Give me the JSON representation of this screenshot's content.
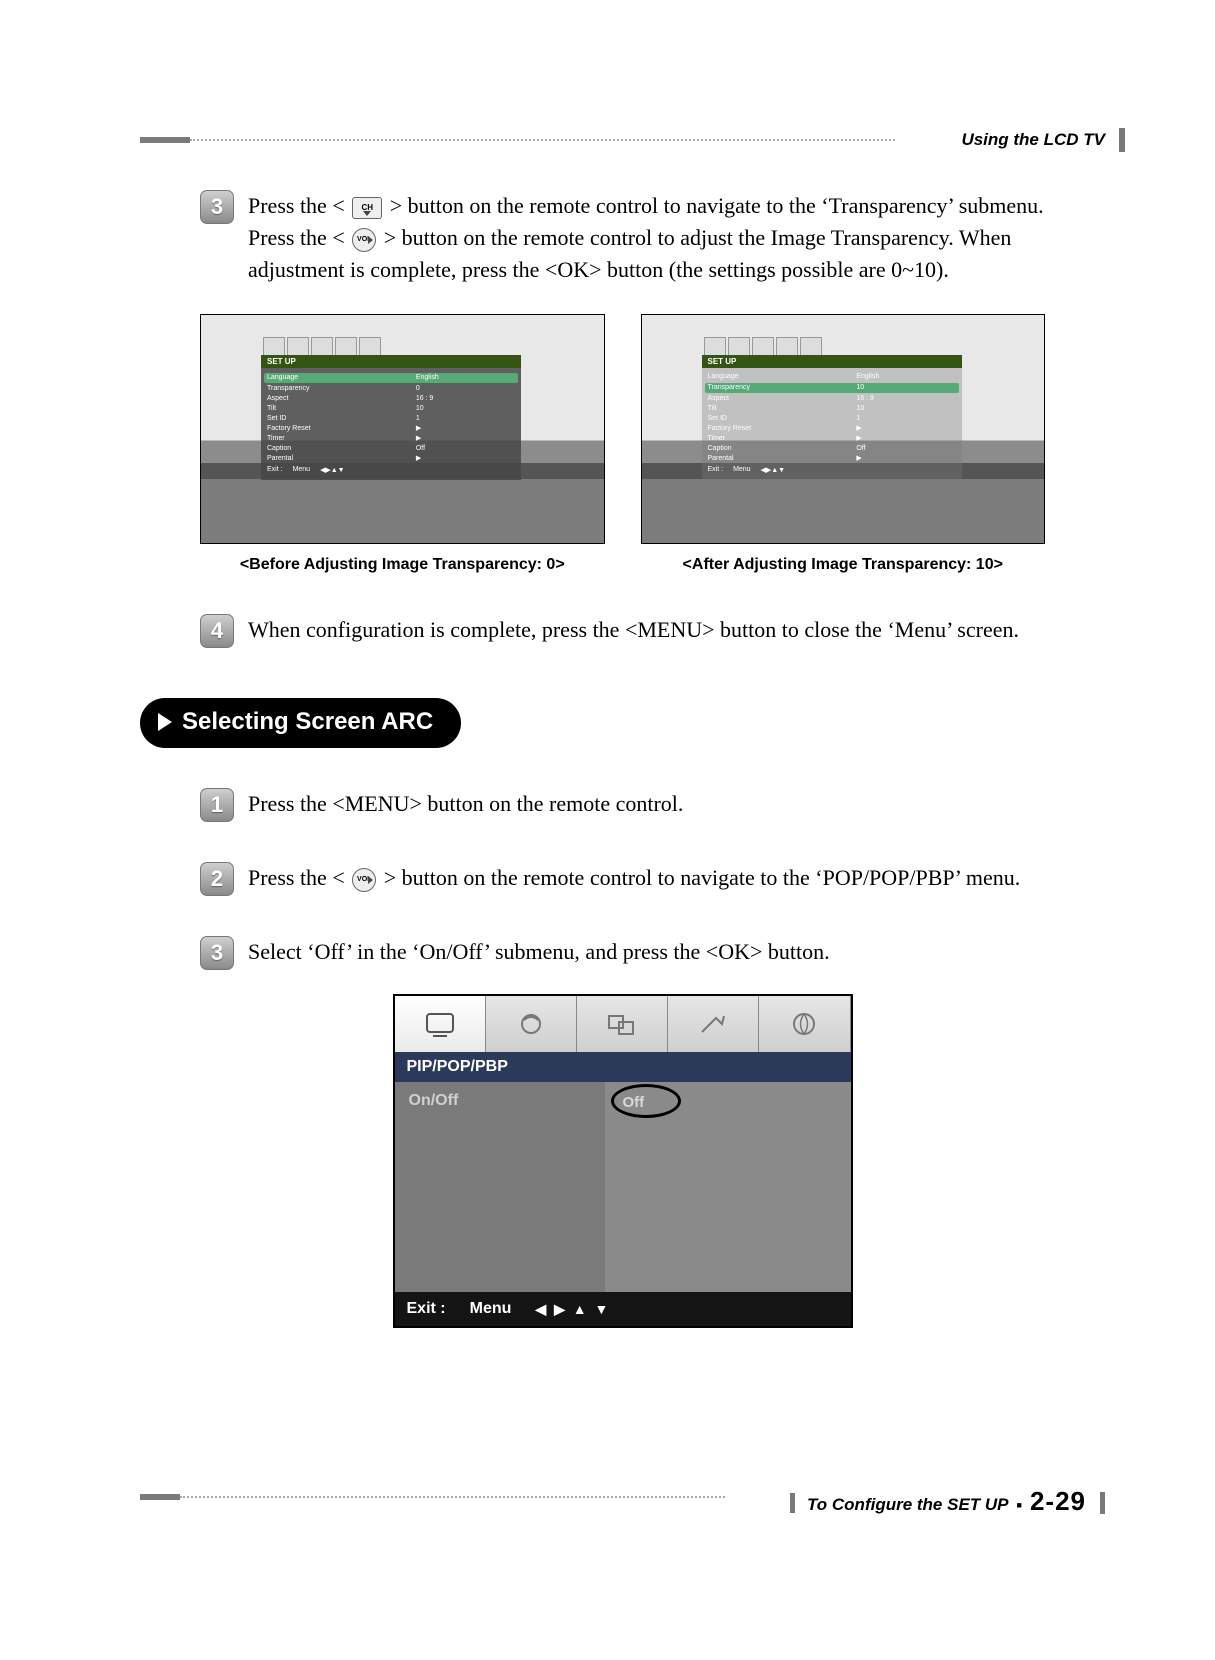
{
  "header": {
    "section": "Using the LCD TV"
  },
  "steps_top": {
    "s3": {
      "num": "3",
      "text_a": "Press the <",
      "text_b": "> button on the remote control to navigate to the ‘Transparency’ submenu. Press the <",
      "text_c": "> button on the remote control to adjust the Image Transparency. When adjustment is complete, press the <OK> button (the settings possible are 0~10)."
    },
    "s4": {
      "num": "4",
      "text": "When configuration is complete, press the <MENU> button to close the ‘Menu’ screen."
    }
  },
  "captions": {
    "before": "<Before Adjusting Image Transparency: 0>",
    "after": "<After Adjusting Image Transparency: 10>"
  },
  "osd_small": {
    "title": "SET UP",
    "rows": {
      "language": {
        "k": "Language",
        "v": "English"
      },
      "transparency0": {
        "k": "Transparency",
        "v": "0"
      },
      "transparency10": {
        "k": "Transparency",
        "v": "10"
      },
      "aspect": {
        "k": "Aspect",
        "v": "16 : 9"
      },
      "tilt": {
        "k": "Tilt",
        "v": "10"
      },
      "setid": {
        "k": "Set ID",
        "v": "1"
      },
      "factory": {
        "k": "Factory Reset",
        "v": ""
      },
      "timer": {
        "k": "Timer",
        "v": ""
      },
      "caption": {
        "k": "Caption",
        "v": "Off"
      },
      "parental": {
        "k": "Parental",
        "v": ""
      }
    },
    "arrows_value": "▶",
    "footer_exit": "Exit :",
    "footer_menu": "Menu",
    "footer_arrows": "◀ ▶ ▲ ▼"
  },
  "section": {
    "title": "Selecting Screen ARC"
  },
  "steps_bottom": {
    "s1": {
      "num": "1",
      "text": "Press the <MENU> button on the remote control."
    },
    "s2": {
      "num": "2",
      "text_a": "Press the <",
      "text_b": "> button on the remote control to navigate to the ‘POP/POP/PBP’ menu."
    },
    "s3": {
      "num": "3",
      "text": "Select ‘Off’ in the ‘On/Off’ submenu, and press the <OK> button."
    }
  },
  "osd_large": {
    "title": "PIP/POP/PBP",
    "left_item": "On/Off",
    "right_value": "Off",
    "footer_exit": "Exit :",
    "footer_menu": "Menu",
    "footer_arrows": "◀ ▶ ▲ ▼"
  },
  "footer": {
    "label": "To Configure the SET UP",
    "page": "2-29"
  }
}
